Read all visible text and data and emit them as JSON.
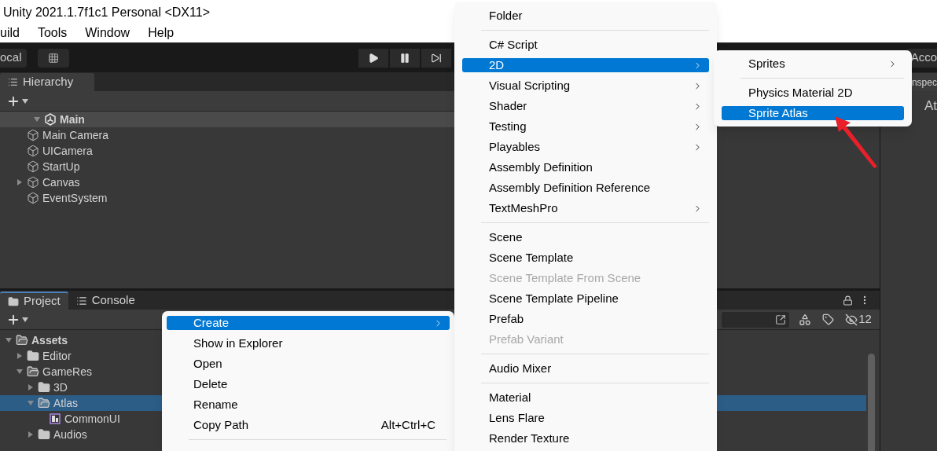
{
  "window": {
    "title": "Unity 2021.1.7f1c1 Personal <DX11>"
  },
  "menu_bar": [
    "uild",
    "Tools",
    "Window",
    "Help"
  ],
  "toolbar": {
    "pivot": "ocal",
    "account": "Acco"
  },
  "hierarchy": {
    "tab": {
      "label": "Hierarchy",
      "selected": true
    },
    "tree": [
      {
        "label": "Main",
        "kind": "scene",
        "expanded": true,
        "children": [
          {
            "label": "Main Camera",
            "kind": "object"
          },
          {
            "label": "UICamera",
            "kind": "object"
          },
          {
            "label": "StartUp",
            "kind": "object"
          },
          {
            "label": "Canvas",
            "kind": "object",
            "expanded": false
          },
          {
            "label": "EventSystem",
            "kind": "object"
          }
        ]
      }
    ]
  },
  "inspector": {
    "tab": "nspec",
    "title": "At"
  },
  "project": {
    "tabs": [
      {
        "label": "Project",
        "selected": true
      },
      {
        "label": "Console",
        "selected": false
      }
    ],
    "hidden_count": "12",
    "tree": [
      {
        "label": "Assets",
        "kind": "folder",
        "expanded": true,
        "selected": false,
        "children": [
          {
            "label": "Editor",
            "kind": "folder",
            "expanded": false,
            "selected": false
          },
          {
            "label": "GameRes",
            "kind": "folder",
            "expanded": true,
            "selected": false,
            "children": [
              {
                "label": "3D",
                "kind": "folder",
                "expanded": false,
                "selected": false
              },
              {
                "label": "Atlas",
                "kind": "folder",
                "expanded": true,
                "selected": true,
                "children": [
                  {
                    "label": "CommonUI",
                    "kind": "atlas",
                    "selected": false
                  }
                ]
              },
              {
                "label": "Audios",
                "kind": "folder",
                "expanded": false,
                "selected": false
              }
            ]
          }
        ]
      }
    ]
  },
  "context_menu": [
    {
      "kind": "item",
      "label": "Create",
      "selected": true,
      "submenu": true
    },
    {
      "kind": "item",
      "label": "Show in Explorer",
      "selected": false,
      "submenu": false
    },
    {
      "kind": "item",
      "label": "Open",
      "selected": false,
      "submenu": false
    },
    {
      "kind": "item",
      "label": "Delete",
      "selected": false,
      "submenu": false
    },
    {
      "kind": "item",
      "label": "Rename",
      "selected": false,
      "submenu": false
    },
    {
      "kind": "item",
      "label": "Copy Path",
      "selected": false,
      "submenu": false,
      "shortcut": "Alt+Ctrl+C"
    },
    {
      "kind": "separator"
    }
  ],
  "create_menu": [
    {
      "kind": "item",
      "label": "Folder",
      "selected": false,
      "submenu": false,
      "disabled": false
    },
    {
      "kind": "separator"
    },
    {
      "kind": "item",
      "label": "C# Script",
      "selected": false,
      "submenu": false,
      "disabled": false
    },
    {
      "kind": "item",
      "label": "2D",
      "selected": true,
      "submenu": true,
      "disabled": false
    },
    {
      "kind": "item",
      "label": "Visual Scripting",
      "selected": false,
      "submenu": true,
      "disabled": false
    },
    {
      "kind": "item",
      "label": "Shader",
      "selected": false,
      "submenu": true,
      "disabled": false
    },
    {
      "kind": "item",
      "label": "Testing",
      "selected": false,
      "submenu": true,
      "disabled": false
    },
    {
      "kind": "item",
      "label": "Playables",
      "selected": false,
      "submenu": true,
      "disabled": false
    },
    {
      "kind": "item",
      "label": "Assembly Definition",
      "selected": false,
      "submenu": false,
      "disabled": false
    },
    {
      "kind": "item",
      "label": "Assembly Definition Reference",
      "selected": false,
      "submenu": false,
      "disabled": false
    },
    {
      "kind": "item",
      "label": "TextMeshPro",
      "selected": false,
      "submenu": true,
      "disabled": false
    },
    {
      "kind": "separator"
    },
    {
      "kind": "item",
      "label": "Scene",
      "selected": false,
      "submenu": false,
      "disabled": false
    },
    {
      "kind": "item",
      "label": "Scene Template",
      "selected": false,
      "submenu": false,
      "disabled": false
    },
    {
      "kind": "item",
      "label": "Scene Template From Scene",
      "selected": false,
      "submenu": false,
      "disabled": true
    },
    {
      "kind": "item",
      "label": "Scene Template Pipeline",
      "selected": false,
      "submenu": false,
      "disabled": false
    },
    {
      "kind": "item",
      "label": "Prefab",
      "selected": false,
      "submenu": false,
      "disabled": false
    },
    {
      "kind": "item",
      "label": "Prefab Variant",
      "selected": false,
      "submenu": false,
      "disabled": true
    },
    {
      "kind": "separator"
    },
    {
      "kind": "item",
      "label": "Audio Mixer",
      "selected": false,
      "submenu": false,
      "disabled": false
    },
    {
      "kind": "separator"
    },
    {
      "kind": "item",
      "label": "Material",
      "selected": false,
      "submenu": false,
      "disabled": false
    },
    {
      "kind": "item",
      "label": "Lens Flare",
      "selected": false,
      "submenu": false,
      "disabled": false
    },
    {
      "kind": "item",
      "label": "Render Texture",
      "selected": false,
      "submenu": false,
      "disabled": false
    }
  ],
  "menu_2d": [
    {
      "kind": "item",
      "label": "Sprites",
      "selected": false,
      "submenu": true
    },
    {
      "kind": "separator"
    },
    {
      "kind": "item",
      "label": "Physics Material 2D",
      "selected": false,
      "submenu": false
    },
    {
      "kind": "item",
      "label": "Sprite Atlas",
      "selected": true,
      "submenu": false
    }
  ]
}
